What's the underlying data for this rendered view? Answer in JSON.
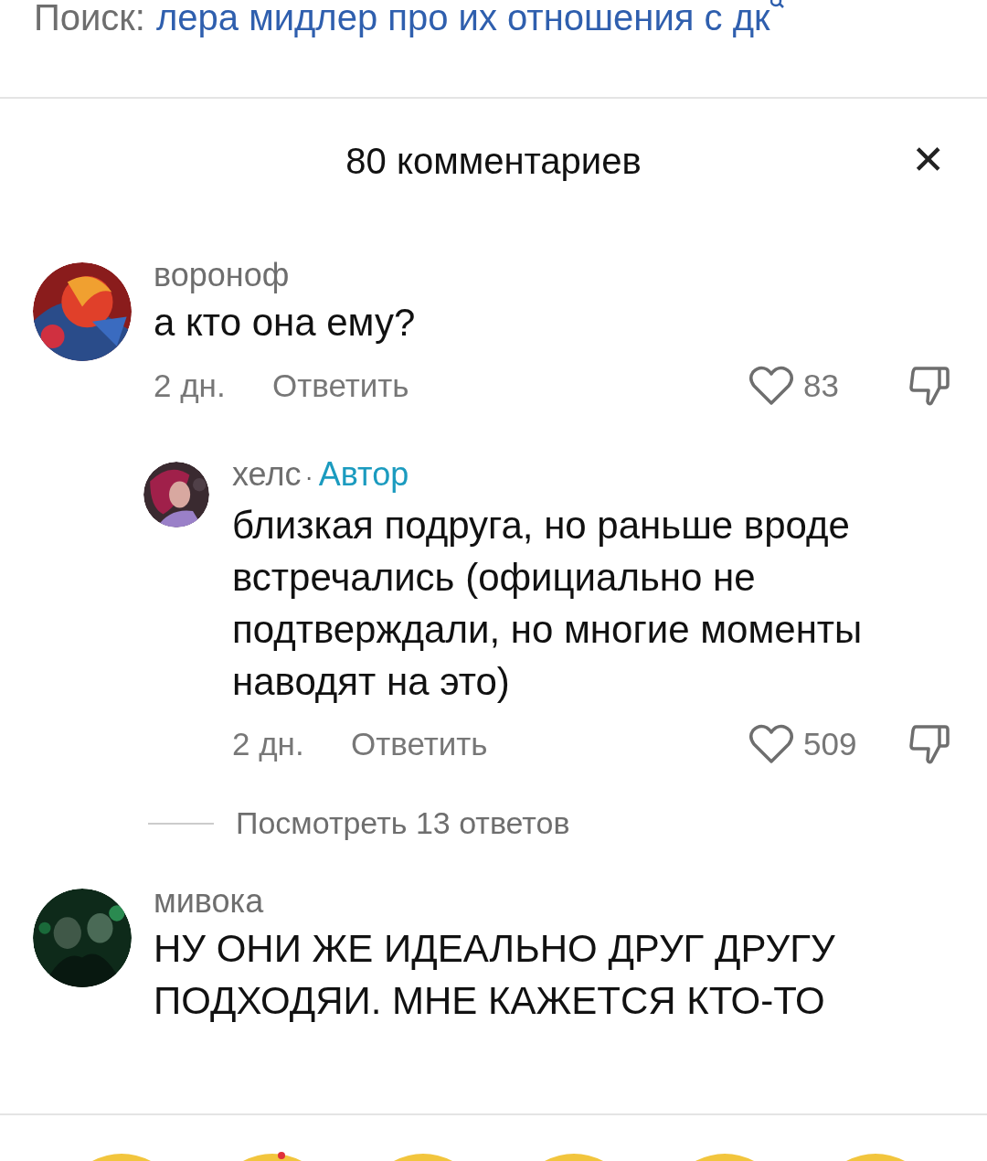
{
  "search": {
    "label": "Поиск:",
    "query": "лера мидлер про их отношения с дк"
  },
  "sheet": {
    "title": "80 комментариев",
    "close": "✕"
  },
  "comments": [
    {
      "author": "вороноф",
      "text": "а кто она ему?",
      "time": "2 дн.",
      "reply_label": "Ответить",
      "likes": "83",
      "replies": [
        {
          "author": "хелс",
          "separator": "·",
          "badge": "Автор",
          "text": "близкая подруга, но раньше вроде встречались (официально не подтверждали, но многие моменты наводят на это)",
          "time": "2 дн.",
          "reply_label": "Ответить",
          "likes": "509"
        }
      ],
      "more_replies": "Посмотреть 13 ответов"
    },
    {
      "author": "мивока",
      "text": "НУ ОНИ ЖЕ ИДЕАЛЬНО ДРУГ ДРУГУ ПОДХОДЯИ. МНЕ КАЖЕТСЯ КТО-ТО"
    }
  ]
}
